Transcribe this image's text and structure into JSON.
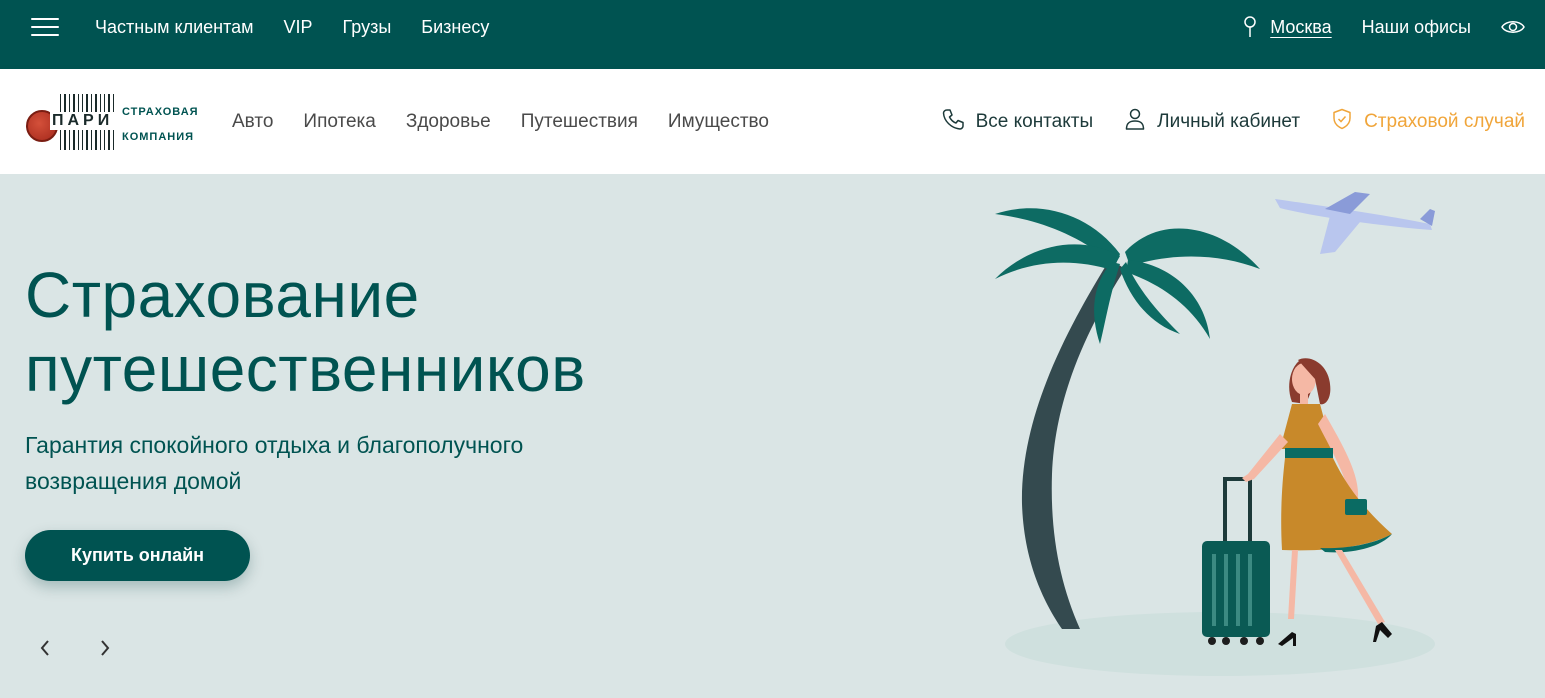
{
  "topbar": {
    "nav": [
      "Частным клиентам",
      "VIP",
      "Грузы",
      "Бизнесу"
    ],
    "city": "Москва",
    "offices": "Наши офисы",
    "icons": {
      "menu": "hamburger-menu-icon",
      "pin": "map-pin-icon",
      "eye": "eye-icon"
    }
  },
  "header": {
    "logo": {
      "word": "ПАРИ",
      "line1": "СТРАХОВАЯ",
      "line2": "КОМПАНИЯ"
    },
    "nav": [
      "Авто",
      "Ипотека",
      "Здоровье",
      "Путешествия",
      "Имущество"
    ],
    "contacts": "Все контакты",
    "cabinet": "Личный кабинет",
    "claim": "Страховой случай"
  },
  "hero": {
    "title_line1": "Страхование",
    "title_line2": "путешественников",
    "subtitle_line1": "Гарантия спокойного отдыха и благополучного",
    "subtitle_line2": "возвращения домой",
    "button": "Купить онлайн"
  },
  "colors": {
    "brand": "#005351",
    "accent": "#f0a53a",
    "hero_bg": "#dae5e5"
  }
}
